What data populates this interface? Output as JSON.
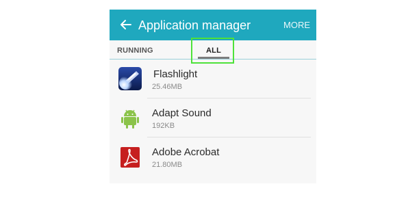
{
  "appbar": {
    "title": "Application manager",
    "more_label": "MORE",
    "back_icon": "arrow-left-icon",
    "color": "#1fa8be"
  },
  "tabs": [
    {
      "label": "RUNNING",
      "selected": false
    },
    {
      "label": "ALL",
      "selected": true
    }
  ],
  "apps": [
    {
      "name": "Flashlight",
      "size": "25.46MB",
      "icon": "flashlight-icon"
    },
    {
      "name": "Adapt Sound",
      "size": "192KB",
      "icon": "android-icon"
    },
    {
      "name": "Adobe Acrobat",
      "size": "21.80MB",
      "icon": "adobe-acrobat-icon"
    }
  ],
  "highlight_color": "#4ee23a"
}
